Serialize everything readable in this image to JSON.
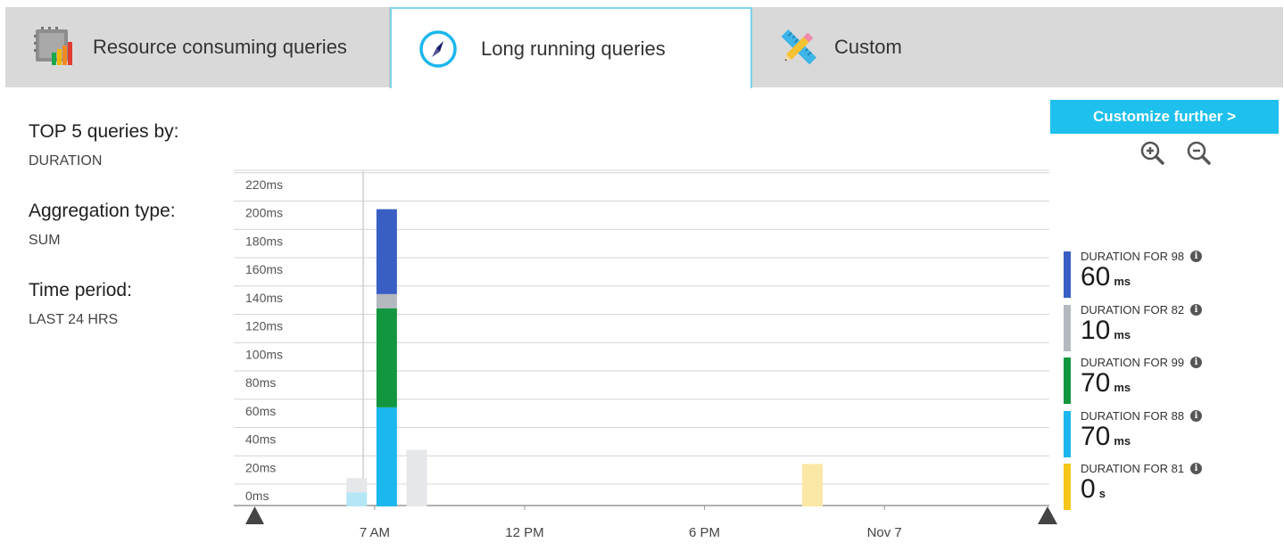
{
  "tabs": [
    {
      "label": "Resource consuming queries",
      "icon": "resource-chart-icon",
      "selected": false
    },
    {
      "label": "Long running queries",
      "icon": "compass-clock-icon",
      "selected": true
    },
    {
      "label": "Custom",
      "icon": "ruler-pencil-icon",
      "selected": false
    }
  ],
  "filters": {
    "top_heading": "TOP 5 queries by:",
    "top_value": "DURATION",
    "aggregation_heading": "Aggregation type:",
    "aggregation_value": "SUM",
    "period_heading": "Time period:",
    "period_value": "LAST 24 HRS"
  },
  "toolbar": {
    "customize_label": "Customize further >",
    "zoom_in_icon": "zoom-in-icon",
    "zoom_out_icon": "zoom-out-icon"
  },
  "colors": {
    "accent": "#1ec0ee",
    "q98": "#3a5fc4",
    "q82": "#b4b8bf",
    "q99": "#12963f",
    "q88": "#1cb7ec",
    "q81": "#f5c518",
    "faded_blue": "#b4e6f6",
    "faded_grey": "#e6e7ea",
    "faded_yellow": "#fbe8a6"
  },
  "legend": [
    {
      "title": "DURATION FOR 98",
      "value": "60",
      "unit": "ms",
      "color": "#3a5fc4"
    },
    {
      "title": "DURATION FOR 82",
      "value": "10",
      "unit": "ms",
      "color": "#b4b8bf"
    },
    {
      "title": "DURATION FOR 99",
      "value": "70",
      "unit": "ms",
      "color": "#12963f"
    },
    {
      "title": "DURATION FOR 88",
      "value": "70",
      "unit": "ms",
      "color": "#1cb7ec"
    },
    {
      "title": "DURATION FOR 81",
      "value": "0",
      "unit": "s",
      "color": "#f5c518"
    }
  ],
  "chart_data": {
    "type": "bar",
    "stacked": true,
    "y_ticks": [
      "220ms",
      "200ms",
      "180ms",
      "160ms",
      "140ms",
      "120ms",
      "100ms",
      "80ms",
      "60ms",
      "40ms",
      "20ms",
      "0ms"
    ],
    "ylim": [
      0,
      220
    ],
    "x_ticks": [
      "7 AM",
      "12 PM",
      "6 PM",
      "Nov 7"
    ],
    "x_tick_hours": [
      7,
      12,
      18,
      24
    ],
    "xlim_hours": [
      2.3,
      29.5
    ],
    "grid": true,
    "bars": [
      {
        "hour": 6.4,
        "segments": [
          {
            "series": "88",
            "value": 10,
            "faded": true
          },
          {
            "series": "82",
            "value": 10,
            "faded": true
          }
        ]
      },
      {
        "hour": 7.4,
        "segments": [
          {
            "series": "88",
            "value": 70
          },
          {
            "series": "99",
            "value": 70
          },
          {
            "series": "82",
            "value": 10
          },
          {
            "series": "98",
            "value": 60
          }
        ]
      },
      {
        "hour": 8.4,
        "segments": [
          {
            "series": "82",
            "value": 40,
            "faded": true
          }
        ]
      },
      {
        "hour": 21.6,
        "segments": [
          {
            "series": "81",
            "value": 30,
            "faded": true
          }
        ]
      }
    ]
  }
}
